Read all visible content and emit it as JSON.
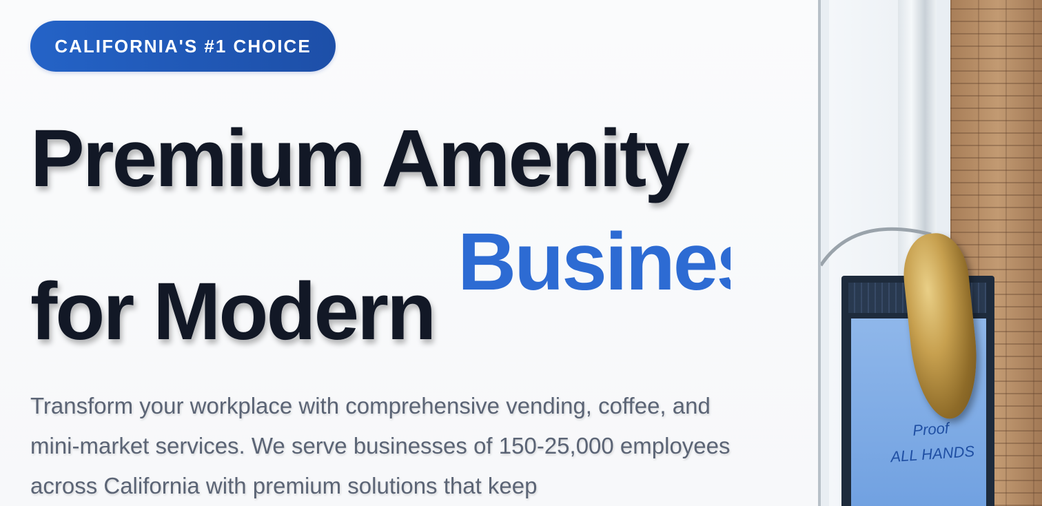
{
  "hero": {
    "badge": "CALIFORNIA'S #1 CHOICE",
    "headline_line1": "Premium Amenity",
    "headline_line2": "for Modern",
    "headline_accent": "Business",
    "subtext": "Transform your workplace with comprehensive vending, coffee, and mini-market services. We serve businesses of 150-25,000 employees across California with premium solutions that keep"
  },
  "photo": {
    "screen_text_line1": "Proof",
    "screen_text_line2": "ALL HANDS"
  },
  "colors": {
    "accent": "#2d6bd3",
    "badge_bg": "#1d4fa8",
    "headline": "#121826",
    "body_text": "#5b6475"
  }
}
